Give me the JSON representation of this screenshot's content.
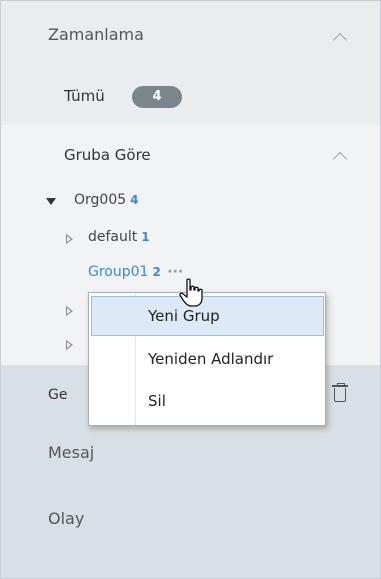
{
  "schedule": {
    "title": "Zamanlama",
    "all_label": "Tümü",
    "all_count": "4"
  },
  "by_group": {
    "title": "Gruba Göre",
    "tree": [
      {
        "label": "Org005",
        "count": "4"
      },
      {
        "label": "default",
        "count": "1"
      },
      {
        "label": "Group01",
        "count": "2",
        "more": "···"
      }
    ]
  },
  "context_menu": {
    "items": [
      "Yeni Grup",
      "Yeniden Adlandır",
      "Sil"
    ]
  },
  "general_partial": "Ge",
  "bottom_nav": [
    "Mesaj",
    "Olay"
  ],
  "colors": {
    "accent": "#3a8bd6",
    "highlight": "#dde9f6"
  },
  "icons": [
    "chevron-up-icon",
    "caret-down-icon",
    "caret-right-icon",
    "more-icon",
    "trash-icon",
    "hand-cursor-icon"
  ]
}
